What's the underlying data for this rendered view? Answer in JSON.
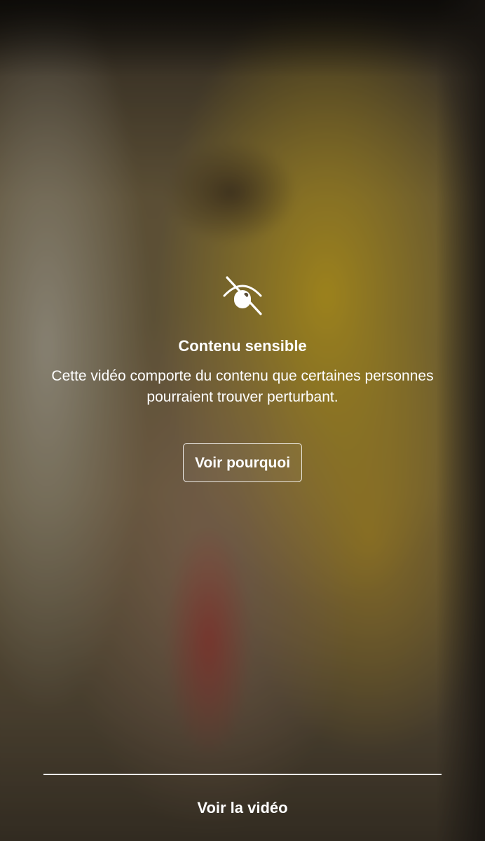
{
  "sensitive_overlay": {
    "icon": "eye-slash-icon",
    "title": "Contenu sensible",
    "description": "Cette vidéo comporte du contenu que certaines personnes pourraient trouver perturbant.",
    "why_button_label": "Voir pourquoi",
    "see_video_label": "Voir la vidéo"
  },
  "colors": {
    "text": "#ffffff",
    "background_tint": "#7a6a48"
  }
}
